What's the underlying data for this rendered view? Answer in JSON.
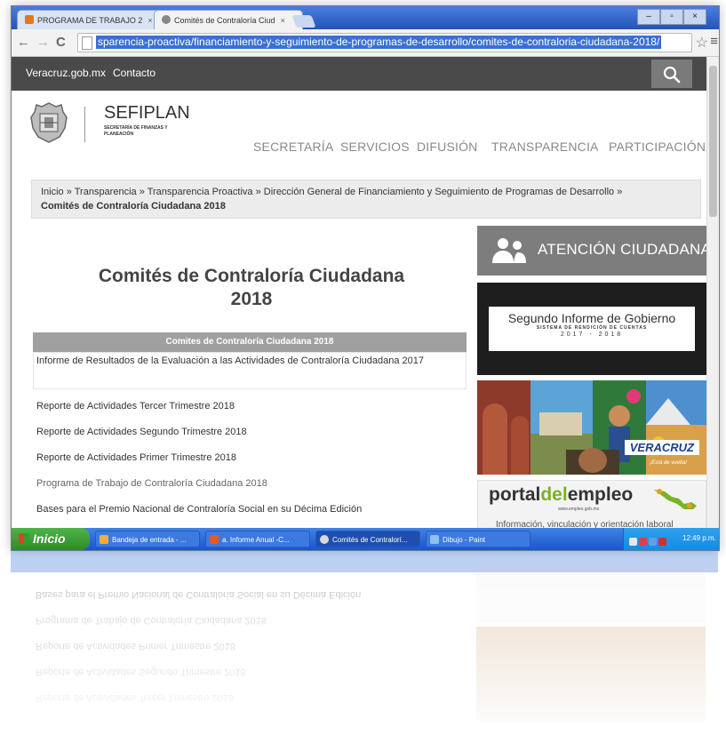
{
  "browser": {
    "tabs": [
      {
        "label": "PROGRAMA DE TRABAJO 2"
      },
      {
        "label": "Comités de Contraloría Ciud"
      }
    ],
    "tab_close": "×",
    "url": "sparencia-proactiva/financiamiento-y-seguimiento-de-programas-de-desarrollo/comites-de-contraloria-ciudadana-2018/"
  },
  "site": {
    "top_links": [
      "Veracruz.gob.mx",
      "Contacto"
    ],
    "logo": {
      "name": "SEFIPLAN",
      "subtitle": "SECRETARÍA DE FINANZAS Y PLANEACIÓN"
    },
    "menu": [
      "SECRETARÍA",
      "SERVICIOS",
      "DIFUSIÓN",
      "TRANSPARENCIA",
      "PARTICIPACIÓN"
    ],
    "breadcrumb": {
      "items": [
        "Inicio",
        "Transparencia",
        "Transparencia Proactiva",
        "Dirección General de Financiamiento y Seguimiento de Programas de Desarrollo"
      ],
      "separator": "»",
      "current": "Comités de Contraloría Ciudadana 2018"
    },
    "page_title_line1": "Comités de Contraloría Ciudadana",
    "page_title_line2": "2018",
    "docs_header": "Comites de Contraloría Ciudadana 2018",
    "docs": [
      "Informe de Resultados de la Evaluación a las Actividades de Contraloría Ciudadana 2017",
      "Reporte de Actividades Tercer Trimestre 2018",
      "Reporte de Actividades Segundo Trimestre 2018",
      "Reporte de Actividades Primer Trimestre 2018",
      "Programa de Trabajo de Contraloría Ciudadana 2018",
      "Bases para el Premio Nacional de Contraloría Social en su Décima Edición"
    ],
    "sidebar": {
      "atencion": "ATENCIÓN CIUDADANA",
      "informe_title": "Segundo Informe de Gobierno",
      "informe_sub": "SISTEMA DE RENDICIÓN DE CUENTAS",
      "informe_years": "2017 - 2018",
      "veracruz_brand": "VERACRUZ",
      "veracruz_tag": "¡Está de vuelta!",
      "portal_pre": "portal",
      "portal_mid": "del",
      "portal_post": "empleo",
      "portal_url": "www.empleo.gob.mx",
      "portal_caption": "Información, vinculación y orientación laboral"
    }
  },
  "taskbar": {
    "start": "Inicio",
    "tasks": [
      "Bandeja de entrada - ...",
      "a. Informe Anual -C...",
      "Comités de Contralorí...",
      "Dibujo - Paint"
    ],
    "clock": "12:49 p.m."
  },
  "colors": {
    "topnav": "#4a4a4a",
    "taskbar": "#1d55c9",
    "start": "#2e8a2a",
    "accent_green": "#7ab324"
  }
}
